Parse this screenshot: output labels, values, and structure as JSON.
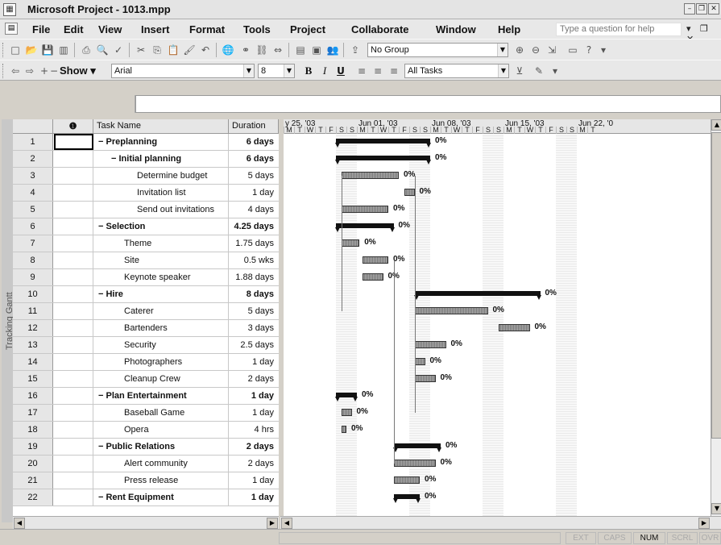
{
  "window": {
    "title": "Microsoft Project - 1013.mpp"
  },
  "menu": {
    "items": [
      "File",
      "Edit",
      "View",
      "Insert",
      "Format",
      "Tools",
      "Project",
      "Collaborate",
      "Window",
      "Help"
    ],
    "help_placeholder": "Type a question for help"
  },
  "toolbar": {
    "group_value": "No Group",
    "show_label": "Show",
    "font_value": "Arial",
    "size_value": "8",
    "filter_value": "All Tasks"
  },
  "view_label": "Tracking Gantt",
  "table": {
    "headers": {
      "id": "",
      "indicator": "i",
      "name": "Task Name",
      "duration": "Duration"
    },
    "rows": [
      {
        "id": "1",
        "name": "Preplanning",
        "duration": "6 days",
        "summary": true,
        "level": 0
      },
      {
        "id": "2",
        "name": "Initial planning",
        "duration": "6 days",
        "summary": true,
        "level": 1
      },
      {
        "id": "3",
        "name": "Determine budget",
        "duration": "5 days",
        "summary": false,
        "level": 2
      },
      {
        "id": "4",
        "name": "Invitation list",
        "duration": "1 day",
        "summary": false,
        "level": 2
      },
      {
        "id": "5",
        "name": "Send out invitations",
        "duration": "4 days",
        "summary": false,
        "level": 2
      },
      {
        "id": "6",
        "name": "Selection",
        "duration": "4.25 days",
        "summary": true,
        "level": 0
      },
      {
        "id": "7",
        "name": "Theme",
        "duration": "1.75 days",
        "summary": false,
        "level": 1
      },
      {
        "id": "8",
        "name": "Site",
        "duration": "0.5 wks",
        "summary": false,
        "level": 1
      },
      {
        "id": "9",
        "name": "Keynote speaker",
        "duration": "1.88 days",
        "summary": false,
        "level": 1
      },
      {
        "id": "10",
        "name": "Hire",
        "duration": "8 days",
        "summary": true,
        "level": 0
      },
      {
        "id": "11",
        "name": "Caterer",
        "duration": "5 days",
        "summary": false,
        "level": 1
      },
      {
        "id": "12",
        "name": "Bartenders",
        "duration": "3 days",
        "summary": false,
        "level": 1
      },
      {
        "id": "13",
        "name": "Security",
        "duration": "2.5 days",
        "summary": false,
        "level": 1
      },
      {
        "id": "14",
        "name": "Photographers",
        "duration": "1 day",
        "summary": false,
        "level": 1
      },
      {
        "id": "15",
        "name": "Cleanup Crew",
        "duration": "2 days",
        "summary": false,
        "level": 1
      },
      {
        "id": "16",
        "name": "Plan Entertainment",
        "duration": "1 day",
        "summary": true,
        "level": 0
      },
      {
        "id": "17",
        "name": "Baseball Game",
        "duration": "1 day",
        "summary": false,
        "level": 1
      },
      {
        "id": "18",
        "name": "Opera",
        "duration": "4 hrs",
        "summary": false,
        "level": 1
      },
      {
        "id": "19",
        "name": "Public Relations",
        "duration": "2 days",
        "summary": true,
        "level": 0
      },
      {
        "id": "20",
        "name": "Alert community",
        "duration": "2 days",
        "summary": false,
        "level": 1
      },
      {
        "id": "21",
        "name": "Press release",
        "duration": "1 day",
        "summary": false,
        "level": 1
      },
      {
        "id": "22",
        "name": "Rent Equipment",
        "duration": "1 day",
        "summary": true,
        "level": 0
      }
    ]
  },
  "timescale": {
    "weeks": [
      "y 25, '03",
      "Jun 01, '03",
      "Jun 08, '03",
      "Jun 15, '03",
      "Jun 22, '0"
    ],
    "day_letters": [
      "M",
      "T",
      "W",
      "T",
      "F",
      "S",
      "S",
      "M",
      "T",
      "W",
      "T",
      "F",
      "S",
      "S",
      "M",
      "T",
      "W",
      "T",
      "F",
      "S",
      "S",
      "M",
      "T",
      "W",
      "T",
      "F",
      "S",
      "S",
      "M",
      "T"
    ]
  },
  "bars": {
    "pct_label": "0%",
    "items": [
      {
        "row": 1,
        "summary": true,
        "start": 5,
        "end": 14
      },
      {
        "row": 2,
        "summary": true,
        "start": 5,
        "end": 14
      },
      {
        "row": 3,
        "summary": false,
        "start": 5.5,
        "end": 11
      },
      {
        "row": 4,
        "summary": false,
        "start": 11.5,
        "end": 12.5
      },
      {
        "row": 5,
        "summary": false,
        "start": 5.5,
        "end": 10
      },
      {
        "row": 6,
        "summary": true,
        "start": 5,
        "end": 10.5
      },
      {
        "row": 7,
        "summary": false,
        "start": 5.5,
        "end": 7.25
      },
      {
        "row": 8,
        "summary": false,
        "start": 7.5,
        "end": 10
      },
      {
        "row": 9,
        "summary": false,
        "start": 7.5,
        "end": 9.5
      },
      {
        "row": 10,
        "summary": true,
        "start": 12.5,
        "end": 24.5
      },
      {
        "row": 11,
        "summary": false,
        "start": 12.5,
        "end": 19.5
      },
      {
        "row": 12,
        "summary": false,
        "start": 20.5,
        "end": 23.5
      },
      {
        "row": 13,
        "summary": false,
        "start": 12.5,
        "end": 15.5
      },
      {
        "row": 14,
        "summary": false,
        "start": 12.5,
        "end": 13.5
      },
      {
        "row": 15,
        "summary": false,
        "start": 12.5,
        "end": 14.5
      },
      {
        "row": 16,
        "summary": true,
        "start": 5,
        "end": 7
      },
      {
        "row": 17,
        "summary": false,
        "start": 5.5,
        "end": 6.5
      },
      {
        "row": 18,
        "summary": false,
        "start": 5.5,
        "end": 6
      },
      {
        "row": 19,
        "summary": true,
        "start": 10.5,
        "end": 15
      },
      {
        "row": 20,
        "summary": false,
        "start": 10.5,
        "end": 14.5
      },
      {
        "row": 21,
        "summary": false,
        "start": 10.5,
        "end": 13
      },
      {
        "row": 22,
        "summary": true,
        "start": 10.5,
        "end": 13
      }
    ]
  },
  "status": [
    "EXT",
    "CAPS",
    "NUM",
    "SCRL",
    "OVR"
  ],
  "status_active": "NUM"
}
